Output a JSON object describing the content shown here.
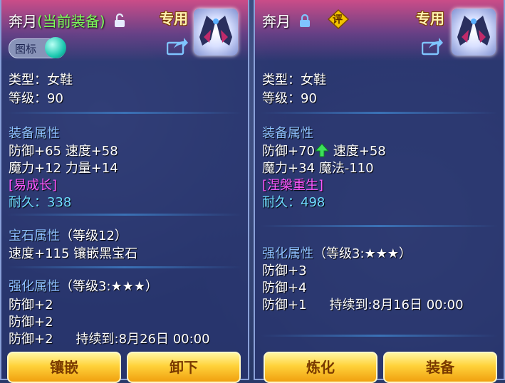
{
  "left": {
    "name": "奔月",
    "equipped_tag": "(当前装备)",
    "lock": "unlocked-lock-icon",
    "special": "专用",
    "icon_toggle_label": "图标",
    "type": "类型：女鞋",
    "level": "等级：90",
    "attr_title": "装备属性",
    "attr1": "防御+65 速度+58",
    "attr2": "魔力+12 力量+14",
    "special_attr": "[易成长]",
    "dur_label": "耐久：",
    "dur_value": "338",
    "gem_title": "宝石属性",
    "gem_level": "（等级12）",
    "gem_line": "速度+115 镶嵌黑宝石",
    "enh_title": "强化属性",
    "enh_level": "（等级3:★★★）",
    "enh1": "防御+2",
    "enh2": "防御+2",
    "enh3": "防御+2",
    "enh3_duration": "持续到:8月26日 00:00",
    "btn1": "镶嵌",
    "btn2": "卸下"
  },
  "right": {
    "name": "奔月",
    "lock": "locked-lock-icon",
    "rating_badge": "评",
    "special": "专用",
    "type": "类型：女鞋",
    "level": "等级：90",
    "attr_title": "装备属性",
    "attr1a": "防御+70",
    "attr1b": "速度+58",
    "attr2": "魔力+34 魔法-110",
    "special_attr": "[涅槃重生]",
    "dur_label": "耐久：",
    "dur_value": "498",
    "enh_title": "强化属性",
    "enh_level": "（等级3:★★★）",
    "enh1": "防御+3",
    "enh2": "防御+4",
    "enh3": "防御+1",
    "enh3_duration": "持续到:8月16日 00:00",
    "btn1": "炼化",
    "btn2": "装备"
  },
  "colors": {
    "section_title": "#8ec1ff",
    "special_attr_left": "#ff58ff",
    "special_attr_right": "#ff58ff",
    "durability": "#6fdcff",
    "equipped_tag": "#7dff5a",
    "button_gold": "#ffd23a"
  }
}
